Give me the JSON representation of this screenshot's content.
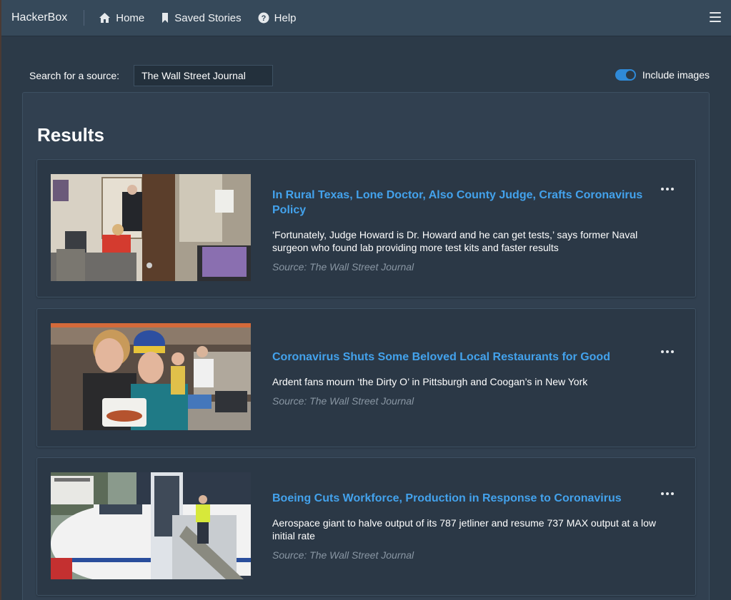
{
  "navbar": {
    "brand": "HackerBox",
    "items": [
      {
        "label": "Home",
        "icon": "home-icon"
      },
      {
        "label": "Saved Stories",
        "icon": "bookmark-icon"
      },
      {
        "label": "Help",
        "icon": "help-icon"
      }
    ],
    "menu_icon": "hamburger-icon"
  },
  "search": {
    "label": "Search for a source:",
    "value": "The Wall Street Journal"
  },
  "include_images": {
    "label": "Include images",
    "enabled": true
  },
  "results": {
    "title": "Results",
    "items": [
      {
        "title": "In Rural Texas, Lone Doctor, Also County Judge, Crafts Coronavirus Policy",
        "description": "‘Fortunately, Judge Howard is Dr. Howard and he can get tests,’ says former Naval surgeon who found lab providing more test kits and faster results",
        "source": "Source: The Wall Street Journal"
      },
      {
        "title": "Coronavirus Shuts Some Beloved Local Restaurants for Good",
        "description": "Ardent fans mourn ‘the Dirty O’ in Pittsburgh and Coogan’s in New York",
        "source": "Source: The Wall Street Journal"
      },
      {
        "title": "Boeing Cuts Workforce, Production in Response to Coronavirus",
        "description": "Aerospace giant to halve output of its 787 jetliner and resume 737 MAX output at a low initial rate",
        "source": "Source: The Wall Street Journal"
      }
    ]
  },
  "colors": {
    "background": "#2c3a48",
    "navbar": "#36495a",
    "link": "#43a2ec",
    "toggle_on": "#2f8ad8"
  }
}
